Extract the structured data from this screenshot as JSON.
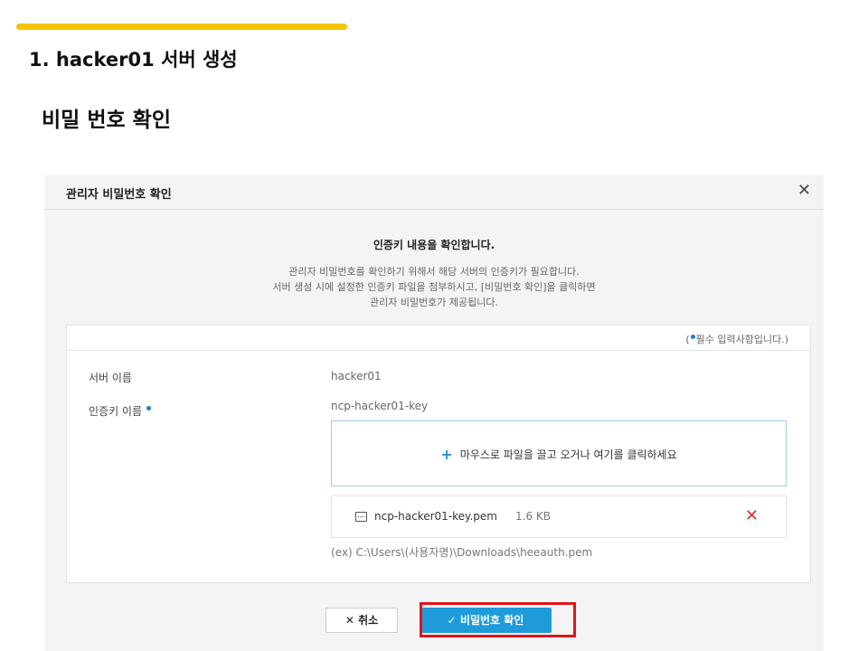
{
  "slide": {
    "title": "1. hacker01 서버 생성",
    "subtitle": "비밀 번호 확인",
    "accent_color": "#f5c400"
  },
  "dialog": {
    "title": "관리자 비밀번호 확인",
    "close_icon": "close-icon",
    "notice": {
      "title": "인증키 내용을 확인합니다.",
      "lines": [
        "관리자 비밀번호를 확인하기 위해서 해당 서버의 인증키가 필요합니다.",
        "서버 생성 시에 설정한 인증키 파일을 첨부하시고, [비밀번호 확인]을 클릭하면",
        "관리자 비밀번호가 제공됩니다."
      ]
    },
    "form": {
      "required_note_prefix": "(",
      "required_note_suffix": "필수 입력사항입니다.)",
      "server_name_label": "서버 이름",
      "server_name_value": "hacker01",
      "auth_key_label": "인증키 이름",
      "auth_key_value": "ncp-hacker01-key",
      "dropzone_text": "마우스로 파일을 끌고 오거나 여기를 클릭하세요",
      "file": {
        "name": "ncp-hacker01-key.pem",
        "size": "1.6 KB"
      },
      "example_path": "(ex) C:\\Users\\(사용자명)\\Downloads\\heeauth.pem"
    },
    "buttons": {
      "cancel": "취소",
      "confirm": "비밀번호 확인"
    },
    "colors": {
      "primary": "#1f9bd9",
      "required_dot": "#1f7fd0",
      "remove": "#e0302a",
      "highlight": "#e0141b"
    }
  }
}
